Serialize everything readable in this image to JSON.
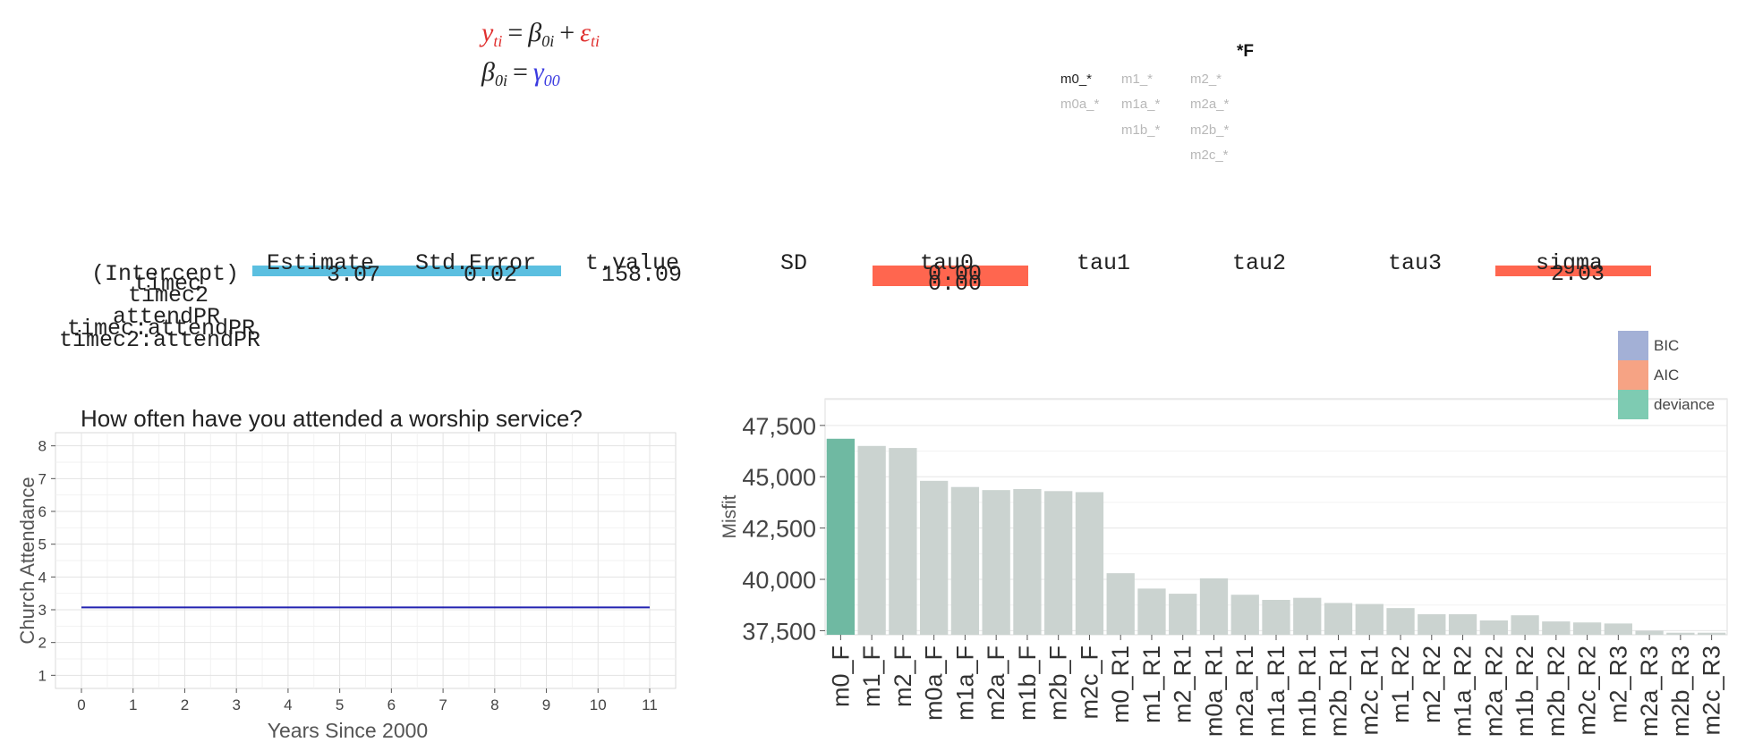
{
  "equations": {
    "level1": {
      "lhs": "y",
      "lhs_sub": "ti",
      "eq": "=",
      "b": "β",
      "b_sub": "0i",
      "plus": "+",
      "e": "ε",
      "e_sub": "ti"
    },
    "level2": {
      "lhs": "β",
      "lhs_sub": "0i",
      "eq": "=",
      "g": "γ",
      "g_sub": "00"
    }
  },
  "model_selector": {
    "title": "*F",
    "items": [
      {
        "label": "m0_*",
        "active": true
      },
      {
        "label": "m1_*",
        "active": false
      },
      {
        "label": "m2_*",
        "active": false
      },
      {
        "label": "m0a_*",
        "active": false
      },
      {
        "label": "m1a_*",
        "active": false
      },
      {
        "label": "m2a_*",
        "active": false
      },
      {
        "label": "m1b_*",
        "active": false
      },
      {
        "label": "m2b_*",
        "active": false
      },
      {
        "label": "m2c_*",
        "active": false
      }
    ]
  },
  "fixed_table": {
    "headers": [
      "Estimate",
      "Std.Error",
      "t.value"
    ],
    "rows": [
      "(Intercept)",
      "timec",
      "timec2",
      "attendPR",
      "timec:attendPR",
      "timec2:attendPR"
    ],
    "values": {
      "estimate": "3.07",
      "std_error": "0.02",
      "t_value": "158.09"
    },
    "bar_color": "#5bbfe0"
  },
  "random_table": {
    "headers": [
      "SD",
      "tau0",
      "tau1",
      "tau2",
      "tau3",
      "sigma"
    ],
    "values": {
      "tau0_a": "0.00",
      "tau0_b": "0.00",
      "sigma": "2.03"
    },
    "bar_color": "#ff664f"
  },
  "chart_data": [
    {
      "type": "line",
      "title": "How often have you attended a worship service?",
      "xlabel": "Years Since 2000",
      "ylabel": "Church Attendance",
      "xlim": [
        0,
        11
      ],
      "ylim": [
        0.6,
        8.4
      ],
      "xticks": [
        0,
        1,
        2,
        3,
        4,
        5,
        6,
        7,
        8,
        9,
        10,
        11
      ],
      "yticks": [
        1,
        2,
        3,
        4,
        5,
        6,
        7,
        8
      ],
      "grid": true,
      "series": [
        {
          "x": [
            0,
            11
          ],
          "y": [
            3.07,
            3.07
          ],
          "color": "#2222b0"
        }
      ]
    },
    {
      "type": "bar",
      "title": "",
      "xlabel": "",
      "ylabel": "Misfit",
      "ylim": [
        37300,
        48800
      ],
      "yticks": [
        37500,
        40000,
        42500,
        45000,
        47500
      ],
      "ytick_labels": [
        "37,500",
        "40,000",
        "42,500",
        "45,000",
        "47,500"
      ],
      "grid": true,
      "legend_position": "top-right",
      "legend": [
        {
          "name": "BIC",
          "color": "#a3b0d6"
        },
        {
          "name": "AIC",
          "color": "#f6a384"
        },
        {
          "name": "deviance",
          "color": "#7ecbb2"
        }
      ],
      "highlight_color": "#6fb9a2",
      "default_color": "#cbd3d0",
      "highlighted": "m0_F",
      "categories": [
        "m0_F",
        "m1_F",
        "m2_F",
        "m0a_F",
        "m1a_F",
        "m2a_F",
        "m1b_F",
        "m2b_F",
        "m2c_F",
        "m0_R1",
        "m1_R1",
        "m2_R1",
        "m0a_R1",
        "m2a_R1",
        "m1a_R1",
        "m1b_R1",
        "m2b_R1",
        "m2c_R1",
        "m1_R2",
        "m2_R2",
        "m1a_R2",
        "m2a_R2",
        "m1b_R2",
        "m2b_R2",
        "m2c_R2",
        "m2_R3",
        "m2a_R3",
        "m2b_R3",
        "m2c_R3"
      ],
      "values": [
        46850,
        46500,
        46400,
        44800,
        44500,
        44350,
        44400,
        44300,
        44250,
        40300,
        39550,
        39300,
        40050,
        39250,
        39000,
        39100,
        38850,
        38800,
        38600,
        38300,
        38300,
        38000,
        38250,
        37950,
        37900,
        37850,
        37500,
        37400,
        37400
      ]
    }
  ]
}
